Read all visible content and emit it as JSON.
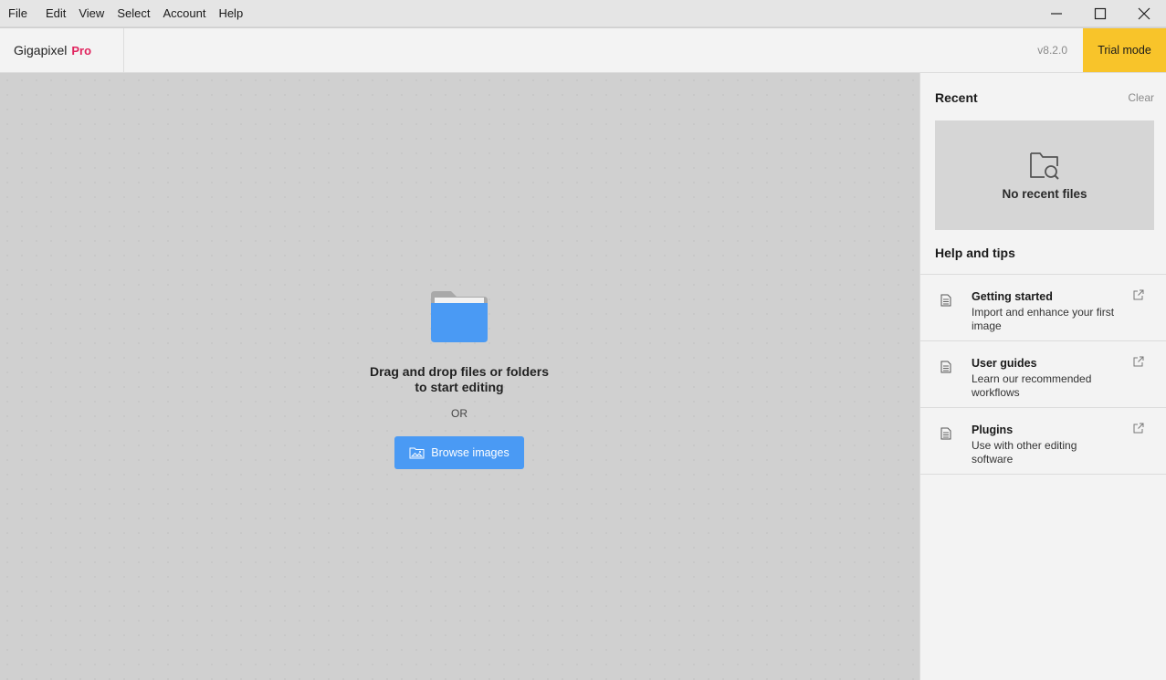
{
  "menu": {
    "items": [
      "File",
      "Edit",
      "View",
      "Select",
      "Account",
      "Help"
    ]
  },
  "window_controls": {
    "minimize_icon": "minimize-icon",
    "maximize_icon": "maximize-icon",
    "close_icon": "close-icon"
  },
  "header": {
    "app_name": "Gigapixel",
    "tier": "Pro",
    "version": "v8.2.0",
    "trial_label": "Trial mode"
  },
  "dropzone": {
    "title": "Drag and drop files or folders to start editing",
    "or": "OR",
    "browse_label": "Browse images"
  },
  "sidebar": {
    "recent_title": "Recent",
    "clear_label": "Clear",
    "no_recent": "No recent files",
    "help_title": "Help and tips",
    "help_items": [
      {
        "title": "Getting started",
        "desc": "Import and enhance your first image"
      },
      {
        "title": "User guides",
        "desc": "Learn our recommended workflows"
      },
      {
        "title": "Plugins",
        "desc": "Use with other editing software"
      }
    ]
  },
  "colors": {
    "accent": "#4a9af4",
    "trial": "#f8c42a",
    "tier": "#e0245e"
  }
}
